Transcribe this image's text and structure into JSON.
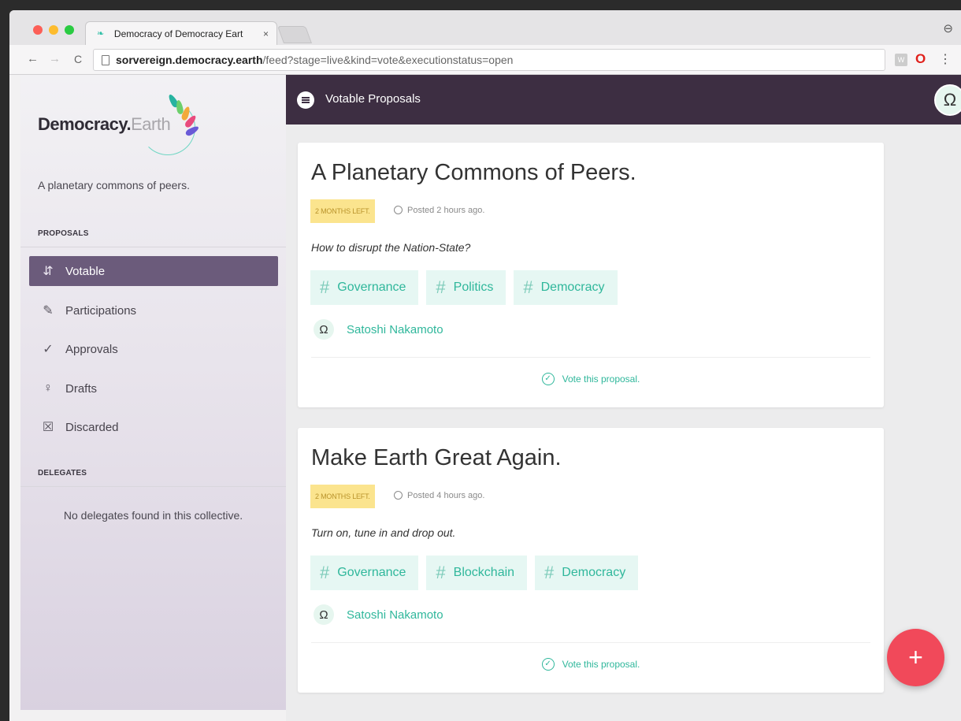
{
  "browser": {
    "tab_title": "Democracy of Democracy Eart",
    "tab_close": "×",
    "url_host": "sorvereign.democracy.earth",
    "url_path": "/feed?stage=live&kind=vote&executionstatus=open",
    "back": "←",
    "forward": "→",
    "reload": "C",
    "ext_label": "W",
    "opera": "O",
    "menu": "⋮",
    "profile": "⊖"
  },
  "sidebar": {
    "logo_bold": "Democracy",
    "logo_light": "Earth",
    "tagline": "A planetary commons of peers.",
    "proposals_label": "PROPOSALS",
    "items": [
      {
        "label": "Votable",
        "icon": "signpost-icon",
        "glyph": "⇵",
        "active": true
      },
      {
        "label": "Participations",
        "icon": "pen-icon",
        "glyph": "✎",
        "active": false
      },
      {
        "label": "Approvals",
        "icon": "check-circle-icon",
        "glyph": "✓",
        "active": false
      },
      {
        "label": "Drafts",
        "icon": "bulb-icon",
        "glyph": "♀",
        "active": false
      },
      {
        "label": "Discarded",
        "icon": "discard-icon",
        "glyph": "☒",
        "active": false
      }
    ],
    "delegates_label": "DELEGATES",
    "delegates_empty": "No delegates found in this collective."
  },
  "topbar": {
    "title": "Votable Proposals",
    "avatar_glyph": "Ω"
  },
  "proposals": [
    {
      "title": "A Planetary Commons of Peers.",
      "badge": "2 MONTHS LEFT.",
      "posted": "Posted 2 hours ago.",
      "description": "How to disrupt the Nation-State?",
      "tags": [
        "Governance",
        "Politics",
        "Democracy"
      ],
      "author": "Satoshi Nakamoto",
      "vote_label": "Vote this proposal."
    },
    {
      "title": "Make Earth Great Again.",
      "badge": "2 MONTHS LEFT.",
      "posted": "Posted 4 hours ago.",
      "description": "Turn on, tune in and drop out.",
      "tags": [
        "Governance",
        "Blockchain",
        "Democracy"
      ],
      "author": "Satoshi Nakamoto",
      "vote_label": "Vote this proposal."
    }
  ],
  "fab_label": "+",
  "hash_glyph": "#",
  "author_glyph": "Ω",
  "check_glyph": "✓",
  "colors": {
    "accent": "#2fb79b",
    "topbar": "#3d2e42",
    "active_nav": "#6b5b7b",
    "fab": "#f1495a",
    "badge": "#fbe48e"
  }
}
